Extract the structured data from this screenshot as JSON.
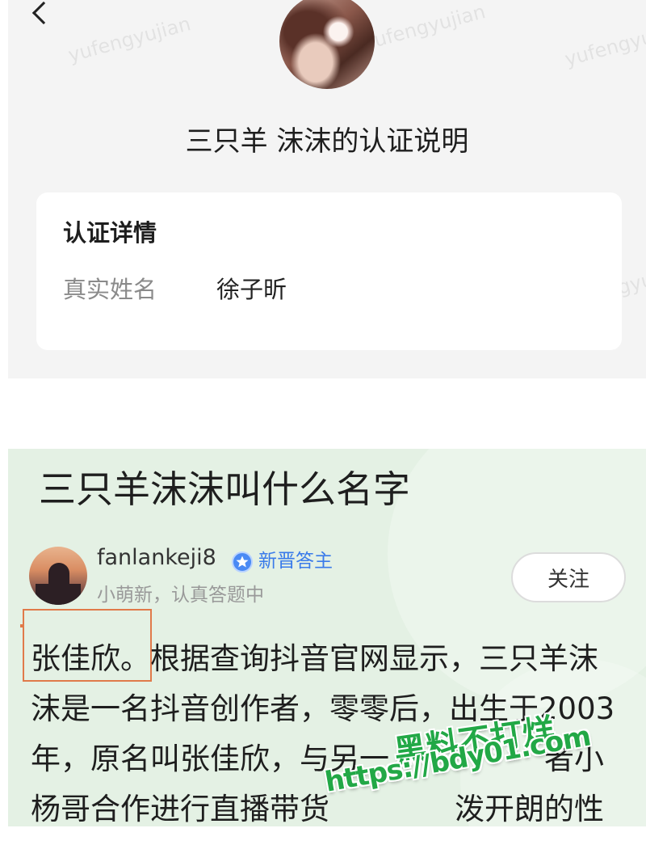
{
  "watermark_text": "yufengyujian",
  "certification": {
    "title": "三只羊 沫沫的认证说明",
    "card_heading": "认证详情",
    "field_label": "真实姓名",
    "field_value": "徐子昕"
  },
  "question": {
    "title": "三只羊沫沫叫什么名字",
    "answerer": {
      "username": "fanlankeji8",
      "badge": "新晋答主",
      "status": "小萌新，认真答题中"
    },
    "follow_label": "关注",
    "answer": {
      "highlight": "张佳欣。",
      "line1_rest": "根据查询抖音官网显示，三只羊沫",
      "line2": "沫是一名抖音创作者，零零后，出生于2003",
      "line3_start": "年，原名叫张佳欣，与另一",
      "line3_end": "者小",
      "line4_start": "杨哥合作进行直播带货",
      "line4_end": "泼开朗的性"
    }
  },
  "overlay_watermark": {
    "brand": "黑料不打烊",
    "url": "https://bdy01.com"
  },
  "icons": {
    "back": "chevron-left-icon",
    "badge": "star-badge-icon"
  },
  "colors": {
    "cert_background": "#f4f4f4",
    "qa_background": "#e4f1e4",
    "badge_blue": "#3a7bea",
    "highlight_box": "#e07a4a",
    "overlay_green": "#22a846"
  }
}
